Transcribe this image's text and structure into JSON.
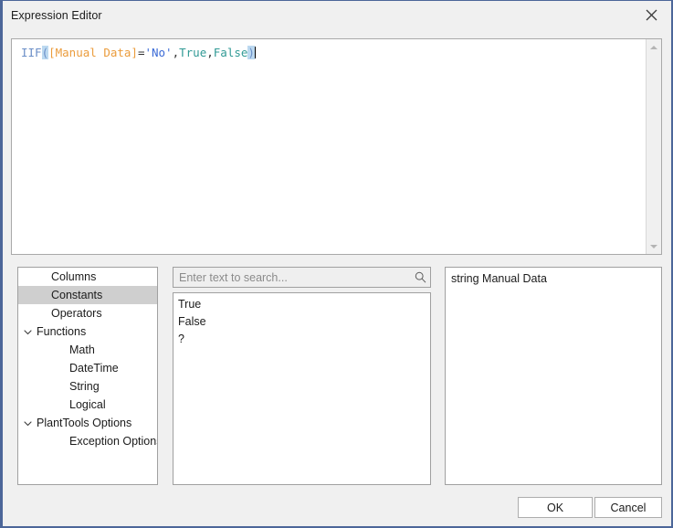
{
  "window": {
    "title": "Expression Editor",
    "close_icon": "close-icon",
    "border_color": "#4c6699",
    "chrome_color": "#f0f0f0"
  },
  "editor": {
    "expression": "IIF([Manual Data]='No',True,False)",
    "tokens": [
      {
        "text": "IIF",
        "type": "function",
        "color": "#6a8ec7"
      },
      {
        "text": "(",
        "type": "paren-match",
        "color": "#6a8ec7"
      },
      {
        "text": "[Manual Data]",
        "type": "column",
        "color": "#eb9c3c"
      },
      {
        "text": "=",
        "type": "operator",
        "color": "#333333"
      },
      {
        "text": "'No'",
        "type": "string",
        "color": "#3c6bd6"
      },
      {
        "text": ",",
        "type": "operator",
        "color": "#333333"
      },
      {
        "text": "True",
        "type": "constant",
        "color": "#309a95"
      },
      {
        "text": ",",
        "type": "operator",
        "color": "#333333"
      },
      {
        "text": "False",
        "type": "constant",
        "color": "#309a95"
      },
      {
        "text": ")",
        "type": "paren-match",
        "color": "#6a8ec7"
      }
    ],
    "scrollbar": {
      "up_icon": "scroll-up-arrow-icon",
      "down_icon": "scroll-down-arrow-icon"
    }
  },
  "tree": {
    "items": [
      {
        "label": "Columns",
        "indent": 1,
        "expandable": false,
        "selected": false
      },
      {
        "label": "Constants",
        "indent": 1,
        "expandable": false,
        "selected": true
      },
      {
        "label": "Operators",
        "indent": 1,
        "expandable": false,
        "selected": false
      },
      {
        "label": "Functions",
        "indent": 0,
        "expandable": true,
        "selected": false
      },
      {
        "label": "Math",
        "indent": 2,
        "expandable": false,
        "selected": false
      },
      {
        "label": "DateTime",
        "indent": 2,
        "expandable": false,
        "selected": false
      },
      {
        "label": "String",
        "indent": 2,
        "expandable": false,
        "selected": false
      },
      {
        "label": "Logical",
        "indent": 2,
        "expandable": false,
        "selected": false
      },
      {
        "label": "PlantTools Options",
        "indent": 0,
        "expandable": true,
        "selected": false
      },
      {
        "label": "Exception Options",
        "indent": 2,
        "expandable": false,
        "selected": false
      }
    ],
    "selection_color": "#cfcfcf"
  },
  "search": {
    "value": "",
    "placeholder": "Enter text to search...",
    "icon": "search-icon"
  },
  "list": {
    "items": [
      {
        "label": "True"
      },
      {
        "label": "False"
      },
      {
        "label": "?"
      }
    ]
  },
  "description": {
    "text": "string Manual Data"
  },
  "footer": {
    "ok_label": "OK",
    "cancel_label": "Cancel"
  }
}
